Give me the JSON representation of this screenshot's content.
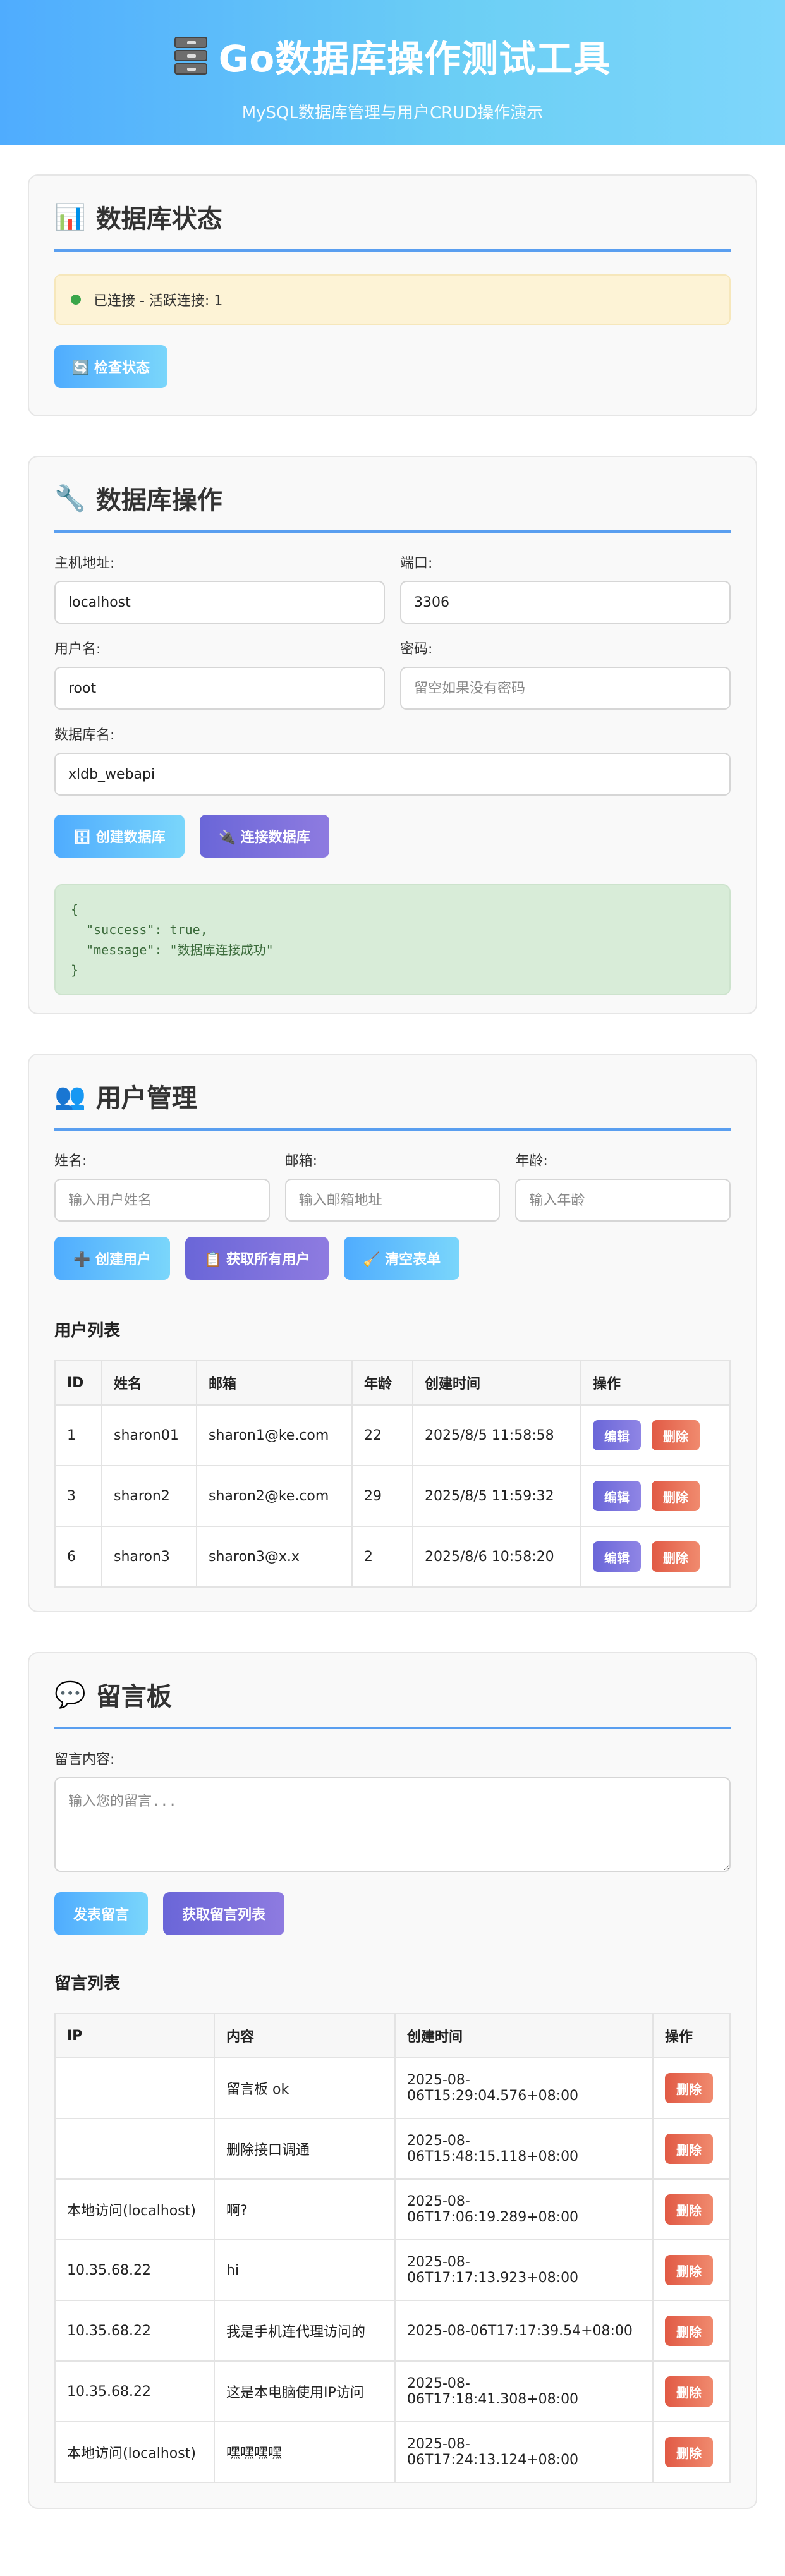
{
  "header": {
    "title": "Go数据库操作测试工具",
    "subtitle": "MySQL数据库管理与用户CRUD操作演示"
  },
  "status_section": {
    "icon": "📊",
    "title": "数据库状态",
    "status_text": "已连接 - 活跃连接: 1",
    "status_color": "#3aa64a",
    "check_button": "🔄 检查状态"
  },
  "db_section": {
    "icon": "🔧",
    "title": "数据库操作",
    "host_label": "主机地址:",
    "host_value": "localhost",
    "port_label": "端口:",
    "port_value": "3306",
    "user_label": "用户名:",
    "user_value": "root",
    "password_label": "密码:",
    "password_placeholder": "留空如果没有密码",
    "dbname_label": "数据库名:",
    "dbname_value": "xldb_webapi",
    "create_button": "🗄 创建数据库",
    "connect_button": "🔌 连接数据库",
    "result_json": "{\n  \"success\": true,\n  \"message\": \"数据库连接成功\"\n}"
  },
  "user_section": {
    "icon": "👥",
    "title": "用户管理",
    "name_label": "姓名:",
    "name_placeholder": "输入用户姓名",
    "email_label": "邮箱:",
    "email_placeholder": "输入邮箱地址",
    "age_label": "年龄:",
    "age_placeholder": "输入年龄",
    "create_button": "➕ 创建用户",
    "fetch_button": "📋 获取所有用户",
    "clear_button": "🧹 清空表单",
    "list_title": "用户列表",
    "columns": [
      "ID",
      "姓名",
      "邮箱",
      "年龄",
      "创建时间",
      "操作"
    ],
    "edit_label": "编辑",
    "delete_label": "删除",
    "rows": [
      {
        "id": "1",
        "name": "sharon01",
        "email": "sharon1@ke.com",
        "age": "22",
        "created": "2025/8/5 11:58:58"
      },
      {
        "id": "3",
        "name": "sharon2",
        "email": "sharon2@ke.com",
        "age": "29",
        "created": "2025/8/5 11:59:32"
      },
      {
        "id": "6",
        "name": "sharon3",
        "email": "sharon3@x.x",
        "age": "2",
        "created": "2025/8/6 10:58:20"
      }
    ]
  },
  "message_section": {
    "icon": "💬",
    "title": "留言板",
    "content_label": "留言内容:",
    "content_placeholder": "输入您的留言...",
    "post_button": "发表留言",
    "fetch_button": "获取留言列表",
    "list_title": "留言列表",
    "columns": [
      "IP",
      "内容",
      "创建时间",
      "操作"
    ],
    "delete_label": "删除",
    "rows": [
      {
        "ip": "",
        "content": "留言板 ok",
        "created": "2025-08-06T15:29:04.576+08:00"
      },
      {
        "ip": "",
        "content": "删除接口调通",
        "created": "2025-08-06T15:48:15.118+08:00"
      },
      {
        "ip": "本地访问(localhost)",
        "content": "啊?",
        "created": "2025-08-06T17:06:19.289+08:00"
      },
      {
        "ip": "10.35.68.22",
        "content": "hi",
        "created": "2025-08-06T17:17:13.923+08:00"
      },
      {
        "ip": "10.35.68.22",
        "content": "我是手机连代理访问的",
        "created": "2025-08-06T17:17:39.54+08:00"
      },
      {
        "ip": "10.35.68.22",
        "content": "这是本电脑使用IP访问",
        "created": "2025-08-06T17:18:41.308+08:00"
      },
      {
        "ip": "本地访问(localhost)",
        "content": "嘿嘿嘿嘿",
        "created": "2025-08-06T17:24:13.124+08:00"
      }
    ]
  }
}
